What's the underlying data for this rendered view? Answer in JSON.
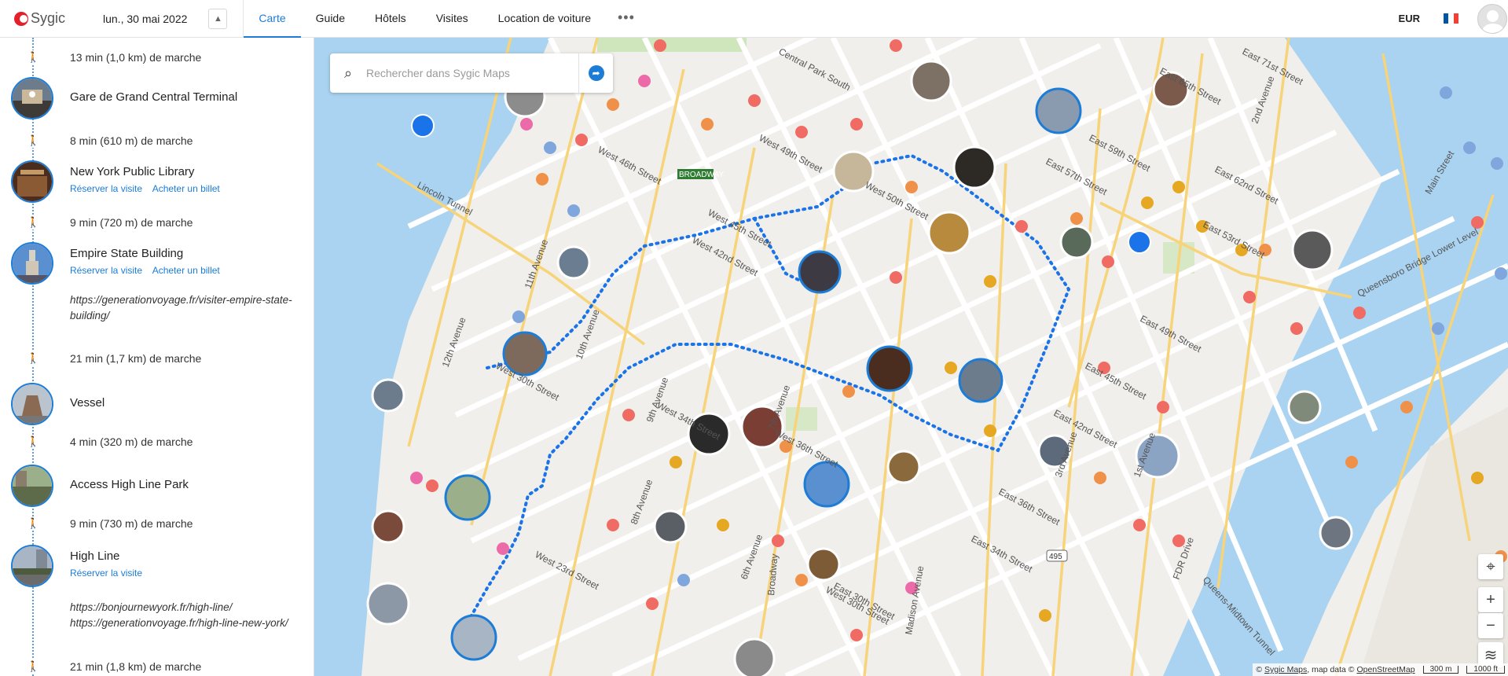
{
  "header": {
    "logo_text": "Sygic",
    "date": "lun., 30 mai 2022",
    "toggle_icon": "chevron-up-icon",
    "nav": [
      "Carte",
      "Guide",
      "Hôtels",
      "Visites",
      "Location de voiture"
    ],
    "active_nav": "Carte",
    "more": "•••",
    "currency": "EUR",
    "flag_colors": [
      "#0055a4",
      "#ffffff",
      "#ef4135"
    ]
  },
  "itinerary": {
    "walks": [
      "13 min (1,0 km) de marche",
      "8 min (610 m) de marche",
      "9 min (720 m) de marche",
      "21 min (1,7 km) de marche",
      "4 min (320 m) de marche",
      "9 min (730 m) de marche",
      "21 min (1,8 km) de marche"
    ],
    "stops": [
      {
        "title": "Gare de Grand Central Terminal",
        "actions": [],
        "notes": []
      },
      {
        "title": "New York Public Library",
        "actions": [
          "Réserver la visite",
          "Acheter un billet"
        ],
        "notes": []
      },
      {
        "title": "Empire State Building",
        "actions": [
          "Réserver la visite",
          "Acheter un billet"
        ],
        "notes": [
          "https://generationvoyage.fr/visiter-empire-state-building/"
        ]
      },
      {
        "title": "Vessel",
        "actions": [],
        "notes": []
      },
      {
        "title": "Access High Line Park",
        "actions": [],
        "notes": []
      },
      {
        "title": "High Line",
        "actions": [
          "Réserver la visite"
        ],
        "notes": [
          "https://bonjournewyork.fr/high-line/",
          "https://generationvoyage.fr/high-line-new-york/"
        ]
      }
    ]
  },
  "map": {
    "search_placeholder": "Rechercher dans Sygic Maps",
    "route_icon": "directions-icon",
    "controls": [
      "locate-icon",
      "zoom-in-icon",
      "zoom-out-icon",
      "layers-icon"
    ],
    "zoom_in": "+",
    "zoom_out": "−",
    "attribution_prefix": "©",
    "attribution_sygic": "Sygic Maps",
    "attribution_mid": ", map data ©",
    "attribution_osm": "OpenStreetMap",
    "scale_metric": "300 m",
    "scale_imperial": "1000 ft",
    "street_labels": [
      "West 42nd Street",
      "West 45th Street",
      "West 46th Street",
      "West 49th Street",
      "West 50th Street",
      "West 30th Street",
      "West 34th Street",
      "West 36th Street",
      "West 23rd Street",
      "West 30th Street",
      "East 57th Street",
      "East 59th Street",
      "East 62nd Street",
      "East 65th Street",
      "East 71st Street",
      "East 53rd Street",
      "East 49th Street",
      "East 45th Street",
      "East 42nd Street",
      "East 34th Street",
      "East 30th Street",
      "East 36th Street",
      "11th Avenue",
      "12th Avenue",
      "10th Avenue",
      "9th Avenue",
      "8th Avenue",
      "7th Avenue",
      "6th Avenue",
      "3rd Avenue",
      "2nd Avenue",
      "1st Avenue",
      "Broadway",
      "Madison Avenue",
      "Lincoln Tunnel",
      "Queensboro Bridge Lower Level",
      "Queens-Midtown Tunnel",
      "FDR Drive",
      "Main Street",
      "Central Park South"
    ],
    "road_sign": "495",
    "broadway_sign": "BROADWAY"
  },
  "colors": {
    "accent": "#1c7cd6",
    "water": "#a9d3f0",
    "route": "#1a73e8",
    "poi_orange": "#f0914a",
    "poi_red": "#ef6b63",
    "poi_yellow": "#e6a722",
    "poi_blue": "#7fa7dd",
    "poi_pink": "#ec6aa8"
  }
}
